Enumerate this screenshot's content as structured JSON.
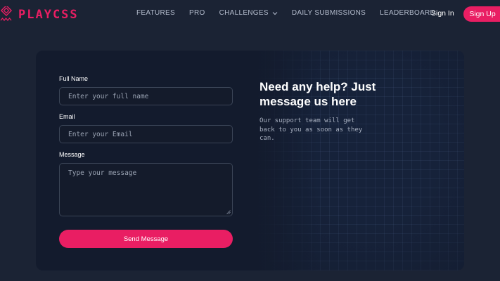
{
  "brand": {
    "name": "PLAYCSS",
    "color": "#e91e63"
  },
  "nav": {
    "links": [
      {
        "label": "FEATURES"
      },
      {
        "label": "PRO"
      },
      {
        "label": "CHALLENGES",
        "icon": "chevron-down-icon"
      },
      {
        "label": "DAILY SUBMISSIONS"
      },
      {
        "label": "LEADERBOARD"
      }
    ],
    "signin_label": "Sign In",
    "signup_label": "Sign Up"
  },
  "form": {
    "name_label": "Full Name",
    "name_placeholder": "Enter your full name",
    "email_label": "Email",
    "email_placeholder": "Enter your Email",
    "message_label": "Message",
    "message_placeholder": "Type your message",
    "submit_label": "Send Message"
  },
  "help": {
    "title": "Need any help? Just message us here",
    "text": "Our support team will get back to you as soon as they can."
  },
  "colors": {
    "background": "#1b2334",
    "card": "#131b2d",
    "accent": "#e91e63"
  }
}
